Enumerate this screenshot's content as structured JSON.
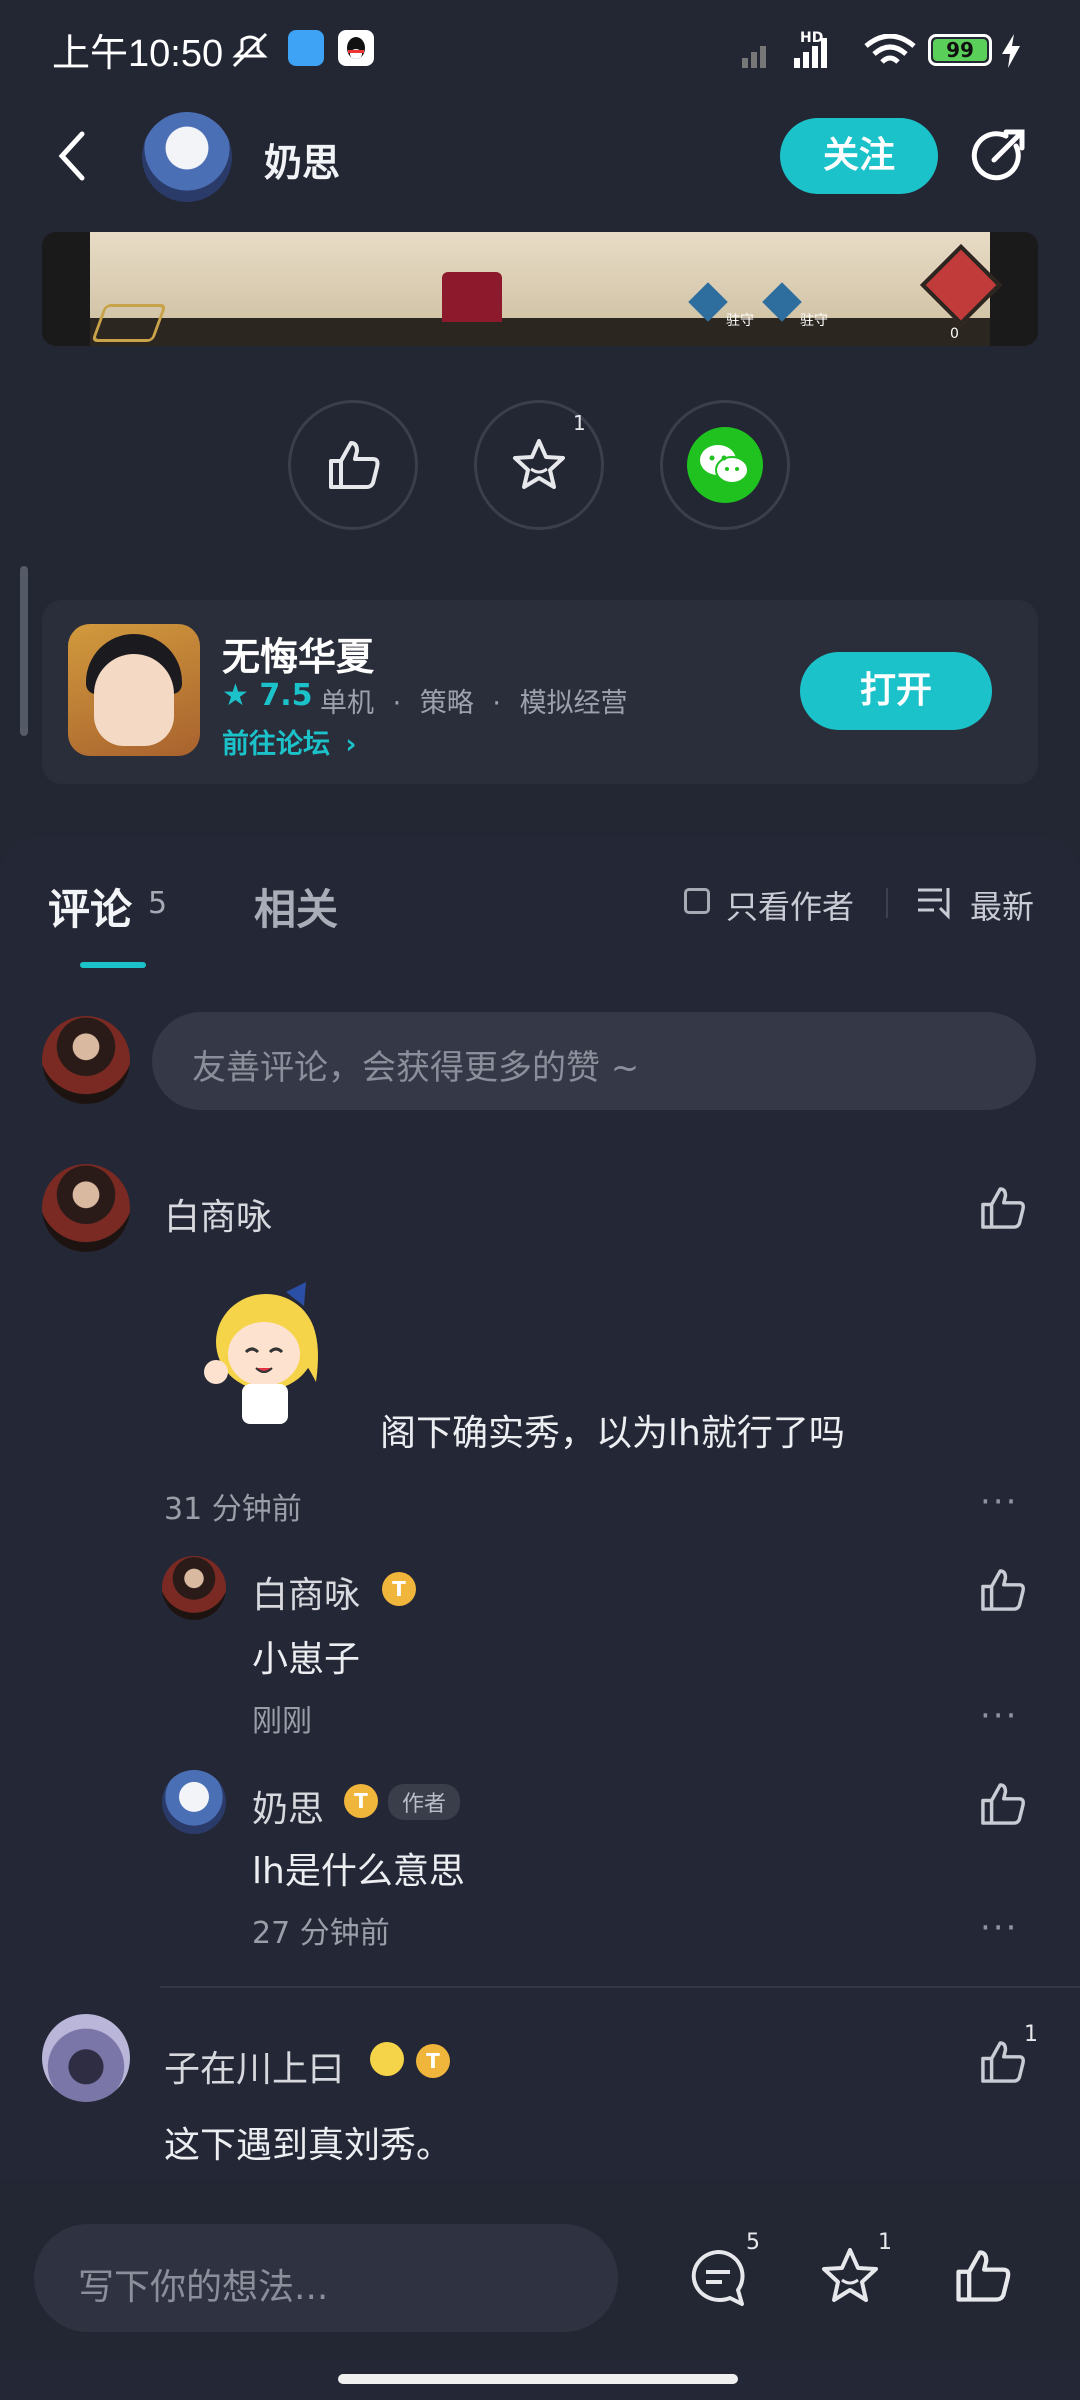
{
  "status_bar": {
    "time": "上午10:50",
    "battery": "99",
    "network": "HD"
  },
  "header": {
    "username": "奶思",
    "follow_label": "关注",
    "back_icon": "chevron-left-icon",
    "share_icon": "share-arrow-icon"
  },
  "actions": {
    "like_icon": "thumbs-up-icon",
    "favorite_icon": "star-icon",
    "favorite_count": "1",
    "wechat_icon": "wechat-icon"
  },
  "game_card": {
    "name": "无悔华夏",
    "rating": "7.5",
    "tags": [
      "单机",
      "策略",
      "模拟经营"
    ],
    "forum_link": "前往论坛",
    "open_label": "打开"
  },
  "media": {
    "unit_label_1": "驻守",
    "unit_label_2": "驻守",
    "counter": "0"
  },
  "tabs": {
    "comments_label": "评论",
    "comments_count": "5",
    "related_label": "相关",
    "only_author_label": "只看作者",
    "sort_label": "最新"
  },
  "comment_input": {
    "placeholder": "友善评论，会获得更多的赞 ~"
  },
  "comments": [
    {
      "user": "白商咏",
      "text": "阁下确实秀，以为lh就行了吗",
      "time": "31 分钟前",
      "more": "···",
      "replies": [
        {
          "user": "白商咏",
          "level": "T",
          "text": "小崽子",
          "time": "刚刚",
          "more": "···"
        },
        {
          "user": "奶思",
          "level": "T",
          "author_tag": "作者",
          "text": "lh是什么意思",
          "time": "27 分钟前",
          "more": "···"
        }
      ]
    },
    {
      "user": "子在川上曰",
      "level": "T",
      "text": "这下遇到真刘秀。",
      "like_count": "1"
    }
  ],
  "bottom_bar": {
    "write_placeholder": "写下你的想法...",
    "comment_count": "5",
    "favorite_count": "1"
  },
  "colors": {
    "accent": "#1cc2c9",
    "background": "#232633",
    "card": "#2a2d3a",
    "level_badge": "#f0b53b"
  }
}
